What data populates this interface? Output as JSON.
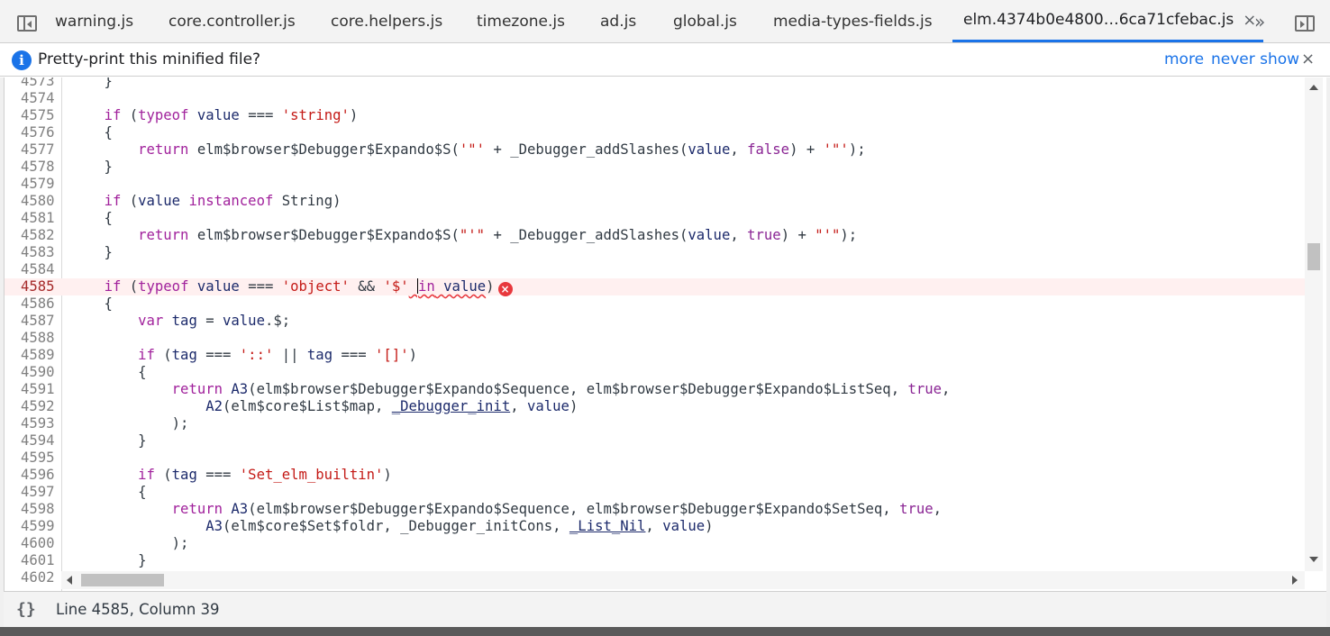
{
  "tabs": [
    {
      "label": "warning.js"
    },
    {
      "label": "core.controller.js"
    },
    {
      "label": "core.helpers.js"
    },
    {
      "label": "timezone.js"
    },
    {
      "label": "ad.js"
    },
    {
      "label": "global.js"
    },
    {
      "label": "media-types-fields.js"
    },
    {
      "label": "elm.4374b0e4800…6ca71cfebac.js",
      "active": true
    }
  ],
  "tab_close_glyph": "×",
  "overflow_glyph": "»",
  "infobar": {
    "icon": "info-icon",
    "message": "Pretty-print this minified file?",
    "more_label": "more",
    "never_show_label": "never show",
    "close_glyph": "×"
  },
  "editor": {
    "lines": [
      {
        "n": "4573"
      },
      {
        "n": "4574"
      },
      {
        "n": "4575"
      },
      {
        "n": "4576"
      },
      {
        "n": "4577"
      },
      {
        "n": "4578"
      },
      {
        "n": "4579"
      },
      {
        "n": "4580"
      },
      {
        "n": "4581"
      },
      {
        "n": "4582"
      },
      {
        "n": "4583"
      },
      {
        "n": "4584"
      },
      {
        "n": "4585"
      },
      {
        "n": "4586"
      },
      {
        "n": "4587"
      },
      {
        "n": "4588"
      },
      {
        "n": "4589"
      },
      {
        "n": "4590"
      },
      {
        "n": "4591"
      },
      {
        "n": "4592"
      },
      {
        "n": "4593"
      },
      {
        "n": "4594"
      },
      {
        "n": "4595"
      },
      {
        "n": "4596"
      },
      {
        "n": "4597"
      },
      {
        "n": "4598"
      },
      {
        "n": "4599"
      },
      {
        "n": "4600"
      },
      {
        "n": "4601"
      },
      {
        "n": "4602"
      }
    ],
    "error_line": "4585",
    "error_glyph": "×"
  },
  "status": {
    "format_glyph": "{}",
    "position": "Line 4585, Column 39"
  },
  "colors": {
    "accent": "#1a73e8",
    "error": "#e8383d",
    "keyword": "#a1229c",
    "string": "#c41a16"
  }
}
